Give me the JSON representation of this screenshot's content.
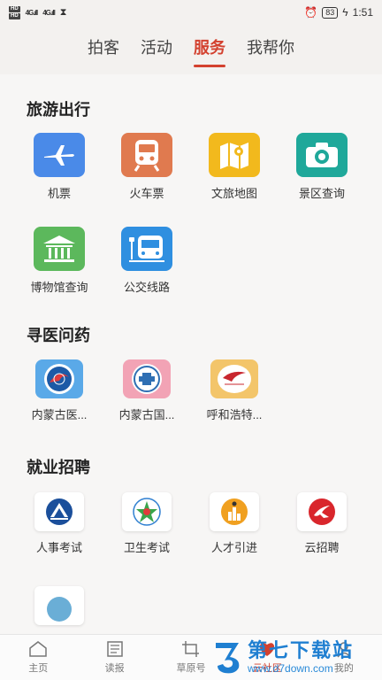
{
  "status_bar": {
    "battery": "83",
    "time": "1:51",
    "net1": "4G",
    "net2": "4G"
  },
  "top_tabs": [
    {
      "label": "拍客",
      "active": false
    },
    {
      "label": "活动",
      "active": false
    },
    {
      "label": "服务",
      "active": true
    },
    {
      "label": "我帮你",
      "active": false
    }
  ],
  "sections": {
    "travel": {
      "title": "旅游出行",
      "items": [
        {
          "label": "机票",
          "icon": "airplane-icon",
          "color": "#4a8ae8"
        },
        {
          "label": "火车票",
          "icon": "train-icon",
          "color": "#e07a4f"
        },
        {
          "label": "文旅地图",
          "icon": "map-icon",
          "color": "#f2b91d"
        },
        {
          "label": "景区查询",
          "icon": "camera-icon",
          "color": "#1fa89a"
        },
        {
          "label": "博物馆查询",
          "icon": "museum-icon",
          "color": "#5cb85c"
        },
        {
          "label": "公交线路",
          "icon": "bus-icon",
          "color": "#2f8fe0"
        }
      ]
    },
    "medical": {
      "title": "寻医问药",
      "items": [
        {
          "label": "内蒙古医...",
          "icon": "hospital-logo-1-icon",
          "color": "#5aa9e8"
        },
        {
          "label": "内蒙古国...",
          "icon": "hospital-logo-2-icon",
          "color": "#f2a3b5"
        },
        {
          "label": "呼和浩特...",
          "icon": "hospital-logo-3-icon",
          "color": "#f3c56a"
        }
      ]
    },
    "jobs": {
      "title": "就业招聘",
      "items": [
        {
          "label": "人事考试",
          "icon": "exam-logo-icon"
        },
        {
          "label": "卫生考试",
          "icon": "health-exam-logo-icon"
        },
        {
          "label": "人才引进",
          "icon": "talent-logo-icon"
        },
        {
          "label": "云招聘",
          "icon": "cloud-recruit-logo-icon"
        }
      ]
    }
  },
  "bottom_nav": [
    {
      "label": "主页",
      "icon": "home-icon"
    },
    {
      "label": "读报",
      "icon": "newspaper-icon"
    },
    {
      "label": "草原号",
      "icon": "crop-icon"
    },
    {
      "label": "云社区",
      "icon": "community-icon"
    },
    {
      "label": "我的",
      "icon": "profile-icon"
    }
  ],
  "watermark": {
    "title": "第七下载站",
    "url": "www.d7down.com"
  },
  "colors": {
    "accent": "#d3412f"
  }
}
